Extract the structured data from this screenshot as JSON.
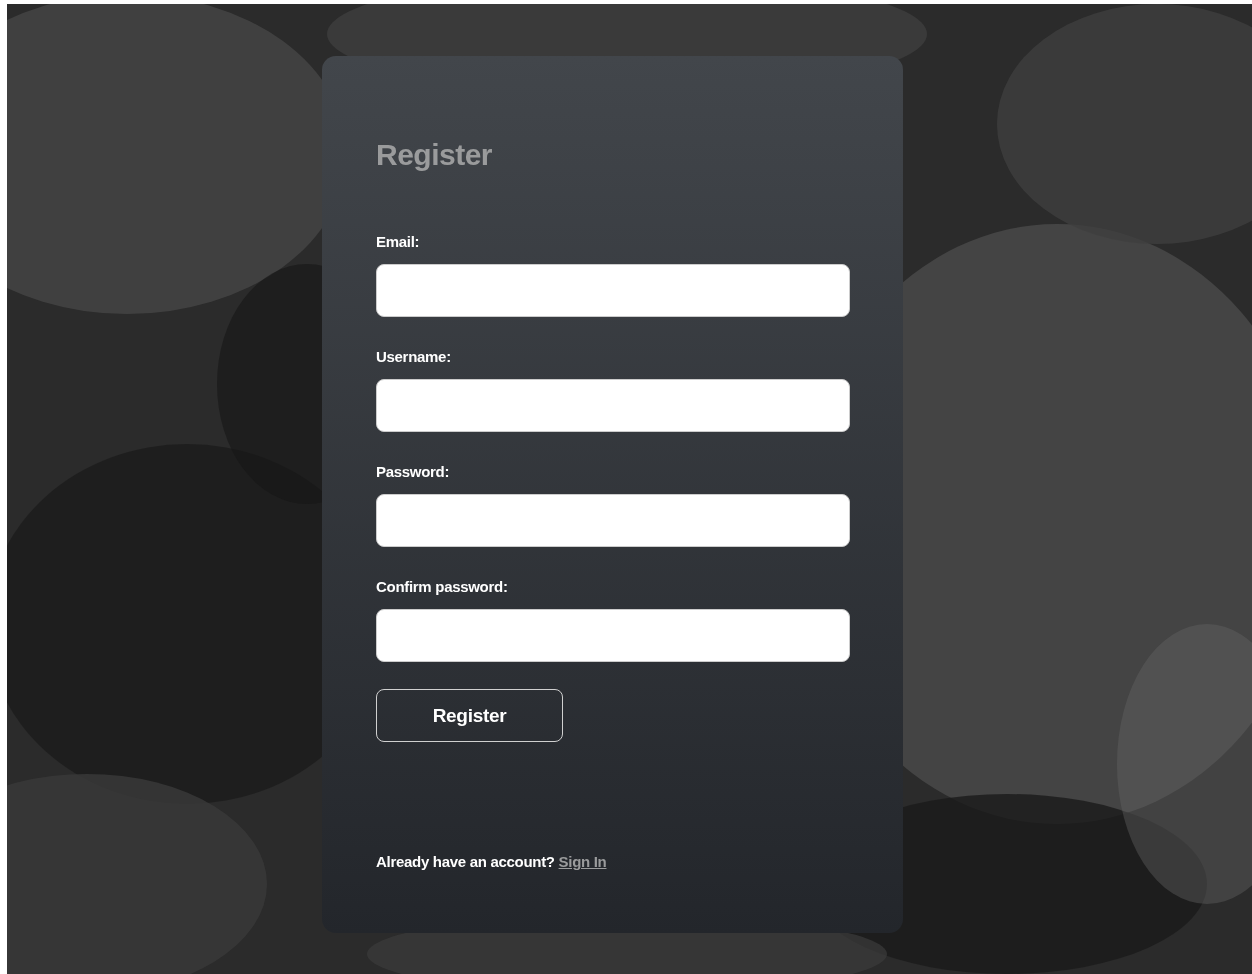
{
  "form": {
    "title": "Register",
    "fields": [
      {
        "label": "Email:"
      },
      {
        "label": "Username:"
      },
      {
        "label": "Password:"
      },
      {
        "label": "Confirm password:"
      }
    ],
    "submit": "Register",
    "footer": {
      "text": "Already have an account?",
      "link": "Sign In"
    }
  }
}
